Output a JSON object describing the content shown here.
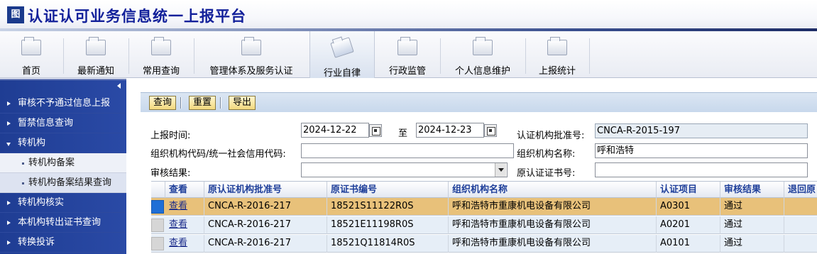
{
  "app": {
    "logo_text": "图",
    "title": "认证认可业务信息统一上报平台"
  },
  "toolbar": {
    "items": [
      {
        "label": "首页"
      },
      {
        "label": "最新通知"
      },
      {
        "label": "常用查询"
      },
      {
        "label": "管理体系及服务认证"
      },
      {
        "label": "行业自律",
        "active": true
      },
      {
        "label": "行政监管"
      },
      {
        "label": "个人信息维护"
      },
      {
        "label": "上报统计"
      }
    ]
  },
  "sidebar": {
    "items": [
      {
        "label": "审核不予通过信息上报",
        "type": "group"
      },
      {
        "label": "暂禁信息查询",
        "type": "group"
      },
      {
        "label": "转机构",
        "type": "group-open"
      },
      {
        "label": "转机构备案",
        "type": "sub"
      },
      {
        "label": "转机构备案结果查询",
        "type": "sub-selected"
      },
      {
        "label": "转机构核实",
        "type": "group"
      },
      {
        "label": "本机构转出证书查询",
        "type": "group"
      },
      {
        "label": "转换投诉",
        "type": "group"
      }
    ]
  },
  "actions": {
    "query": "查询",
    "reset": "重置",
    "export": "导出"
  },
  "form": {
    "report_time_label": "上报时间:",
    "date_from": "2024-12-22",
    "to_label": "至",
    "date_to": "2024-12-23",
    "approval_no_label": "认证机构批准号:",
    "approval_no_value": "CNCA-R-2015-197",
    "org_code_label": "组织机构代码/统一社会信用代码:",
    "org_code_value": "",
    "org_name_label": "组织机构名称:",
    "org_name_value": "呼和浩特",
    "review_result_label": "审核结果:",
    "review_result_value": "",
    "orig_cert_label": "原认证证书号:",
    "orig_cert_value": ""
  },
  "grid": {
    "columns": [
      "查看",
      "原认证机构批准号",
      "原证书编号",
      "组织机构名称",
      "认证项目",
      "审核结果",
      "退回原"
    ],
    "rows": [
      {
        "view": "查看",
        "approval": "CNCA-R-2016-217",
        "cert": "18521S11122R0S",
        "org": "呼和浩特市重康机电设备有限公司",
        "project": "A0301",
        "result": "通过"
      },
      {
        "view": "查看",
        "approval": "CNCA-R-2016-217",
        "cert": "18521E11198R0S",
        "org": "呼和浩特市重康机电设备有限公司",
        "project": "A0201",
        "result": "通过"
      },
      {
        "view": "查看",
        "approval": "CNCA-R-2016-217",
        "cert": "18521Q11814R0S",
        "org": "呼和浩特市重康机电设备有限公司",
        "project": "A0101",
        "result": "通过"
      }
    ]
  },
  "colors": {
    "sidebar": "#2a4aa6",
    "selected_row": "#e8c17a",
    "title": "#12209a"
  }
}
